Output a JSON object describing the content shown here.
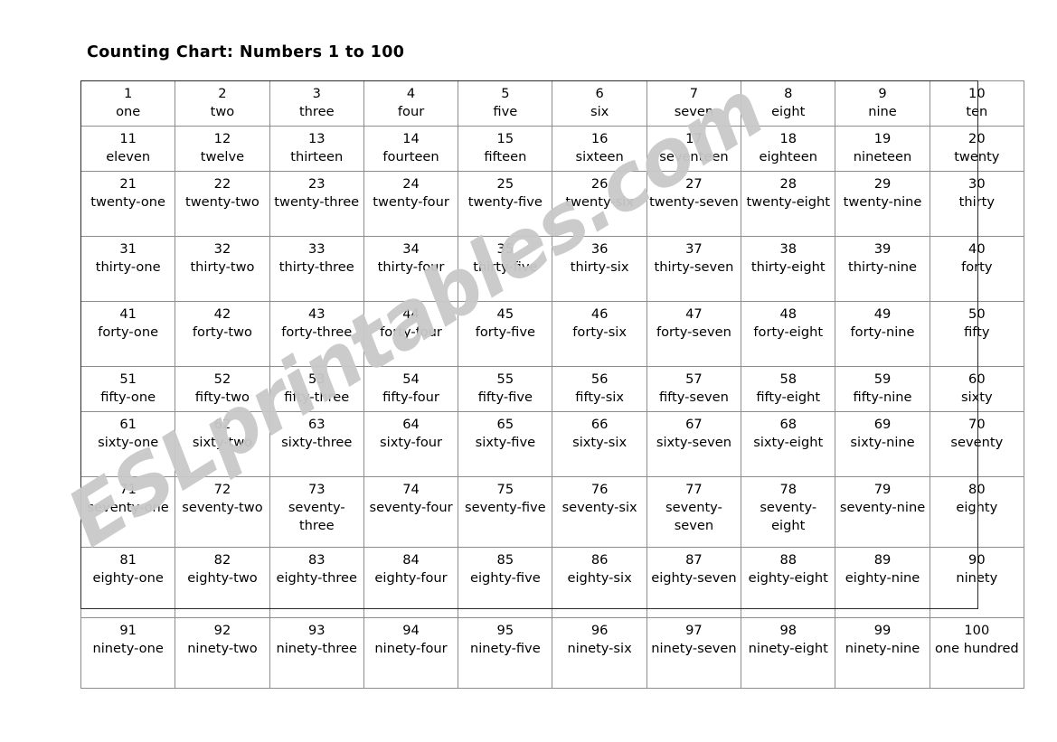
{
  "page": {
    "title": "Counting Chart: Numbers 1 to 100",
    "background_color": "#ffffff",
    "text_color": "#000000",
    "grid_line_color": "#8d8d8d",
    "outer_border_color": "#2b2b2b"
  },
  "watermark": {
    "text": "ESLprintables.com",
    "color": "#c9c9c9",
    "rotation_deg": -32
  },
  "chart_data": {
    "type": "table",
    "title": "Counting Chart: Numbers 1 to 100",
    "columns": 10,
    "rows": 10,
    "cell_fields": [
      "number",
      "word"
    ],
    "cells": [
      [
        {
          "number": "1",
          "word": "one"
        },
        {
          "number": "2",
          "word": "two"
        },
        {
          "number": "3",
          "word": "three"
        },
        {
          "number": "4",
          "word": "four"
        },
        {
          "number": "5",
          "word": "five"
        },
        {
          "number": "6",
          "word": "six"
        },
        {
          "number": "7",
          "word": "seven"
        },
        {
          "number": "8",
          "word": "eight"
        },
        {
          "number": "9",
          "word": "nine"
        },
        {
          "number": "10",
          "word": "ten"
        }
      ],
      [
        {
          "number": "11",
          "word": "eleven"
        },
        {
          "number": "12",
          "word": "twelve"
        },
        {
          "number": "13",
          "word": "thirteen"
        },
        {
          "number": "14",
          "word": "fourteen"
        },
        {
          "number": "15",
          "word": "fifteen"
        },
        {
          "number": "16",
          "word": "sixteen"
        },
        {
          "number": "17",
          "word": "seventeen"
        },
        {
          "number": "18",
          "word": "eighteen"
        },
        {
          "number": "19",
          "word": "nineteen"
        },
        {
          "number": "20",
          "word": "twenty"
        }
      ],
      [
        {
          "number": "21",
          "word": "twenty-one"
        },
        {
          "number": "22",
          "word": "twenty-two"
        },
        {
          "number": "23",
          "word": "twenty-three"
        },
        {
          "number": "24",
          "word": "twenty-four"
        },
        {
          "number": "25",
          "word": "twenty-five"
        },
        {
          "number": "26",
          "word": "twenty-six"
        },
        {
          "number": "27",
          "word": "twenty-seven"
        },
        {
          "number": "28",
          "word": "twenty-eight"
        },
        {
          "number": "29",
          "word": "twenty-nine"
        },
        {
          "number": "30",
          "word": "thirty"
        }
      ],
      [
        {
          "number": "31",
          "word": "thirty-one"
        },
        {
          "number": "32",
          "word": "thirty-two"
        },
        {
          "number": "33",
          "word": "thirty-three"
        },
        {
          "number": "34",
          "word": "thirty-four"
        },
        {
          "number": "35",
          "word": "thirty-five"
        },
        {
          "number": "36",
          "word": "thirty-six"
        },
        {
          "number": "37",
          "word": "thirty-seven"
        },
        {
          "number": "38",
          "word": "thirty-eight"
        },
        {
          "number": "39",
          "word": "thirty-nine"
        },
        {
          "number": "40",
          "word": "forty"
        }
      ],
      [
        {
          "number": "41",
          "word": "forty-one"
        },
        {
          "number": "42",
          "word": "forty-two"
        },
        {
          "number": "43",
          "word": "forty-three"
        },
        {
          "number": "44",
          "word": "forty-four"
        },
        {
          "number": "45",
          "word": "forty-five"
        },
        {
          "number": "46",
          "word": "forty-six"
        },
        {
          "number": "47",
          "word": "forty-seven"
        },
        {
          "number": "48",
          "word": "forty-eight"
        },
        {
          "number": "49",
          "word": "forty-nine"
        },
        {
          "number": "50",
          "word": "fifty"
        }
      ],
      [
        {
          "number": "51",
          "word": "fifty-one"
        },
        {
          "number": "52",
          "word": "fifty-two"
        },
        {
          "number": "53",
          "word": "fifty-three"
        },
        {
          "number": "54",
          "word": "fifty-four"
        },
        {
          "number": "55",
          "word": "fifty-five"
        },
        {
          "number": "56",
          "word": "fifty-six"
        },
        {
          "number": "57",
          "word": "fifty-seven"
        },
        {
          "number": "58",
          "word": "fifty-eight"
        },
        {
          "number": "59",
          "word": "fifty-nine"
        },
        {
          "number": "60",
          "word": "sixty"
        }
      ],
      [
        {
          "number": "61",
          "word": "sixty-one"
        },
        {
          "number": "62",
          "word": "sixty-two"
        },
        {
          "number": "63",
          "word": "sixty-three"
        },
        {
          "number": "64",
          "word": "sixty-four"
        },
        {
          "number": "65",
          "word": "sixty-five"
        },
        {
          "number": "66",
          "word": "sixty-six"
        },
        {
          "number": "67",
          "word": "sixty-seven"
        },
        {
          "number": "68",
          "word": "sixty-eight"
        },
        {
          "number": "69",
          "word": "sixty-nine"
        },
        {
          "number": "70",
          "word": "seventy"
        }
      ],
      [
        {
          "number": "71",
          "word": "seventy-one"
        },
        {
          "number": "72",
          "word": "seventy-two"
        },
        {
          "number": "73",
          "word": "seventy-three"
        },
        {
          "number": "74",
          "word": "seventy-four"
        },
        {
          "number": "75",
          "word": "seventy-five"
        },
        {
          "number": "76",
          "word": "seventy-six"
        },
        {
          "number": "77",
          "word": "seventy-seven"
        },
        {
          "number": "78",
          "word": "seventy-eight"
        },
        {
          "number": "79",
          "word": "seventy-nine"
        },
        {
          "number": "80",
          "word": "eighty"
        }
      ],
      [
        {
          "number": "81",
          "word": "eighty-one"
        },
        {
          "number": "82",
          "word": "eighty-two"
        },
        {
          "number": "83",
          "word": "eighty-three"
        },
        {
          "number": "84",
          "word": "eighty-four"
        },
        {
          "number": "85",
          "word": "eighty-five"
        },
        {
          "number": "86",
          "word": "eighty-six"
        },
        {
          "number": "87",
          "word": "eighty-seven"
        },
        {
          "number": "88",
          "word": "eighty-eight"
        },
        {
          "number": "89",
          "word": "eighty-nine"
        },
        {
          "number": "90",
          "word": "ninety"
        }
      ],
      [
        {
          "number": "91",
          "word": "ninety-one"
        },
        {
          "number": "92",
          "word": "ninety-two"
        },
        {
          "number": "93",
          "word": "ninety-three"
        },
        {
          "number": "94",
          "word": "ninety-four"
        },
        {
          "number": "95",
          "word": "ninety-five"
        },
        {
          "number": "96",
          "word": "ninety-six"
        },
        {
          "number": "97",
          "word": "ninety-seven"
        },
        {
          "number": "98",
          "word": "ninety-eight"
        },
        {
          "number": "99",
          "word": "ninety-nine"
        },
        {
          "number": "100",
          "word": "one hundred"
        }
      ]
    ],
    "row_heights": [
      "short",
      "short",
      "tall",
      "tall",
      "tall",
      "short",
      "tall",
      "xtall",
      "xtall",
      "xtall"
    ]
  }
}
